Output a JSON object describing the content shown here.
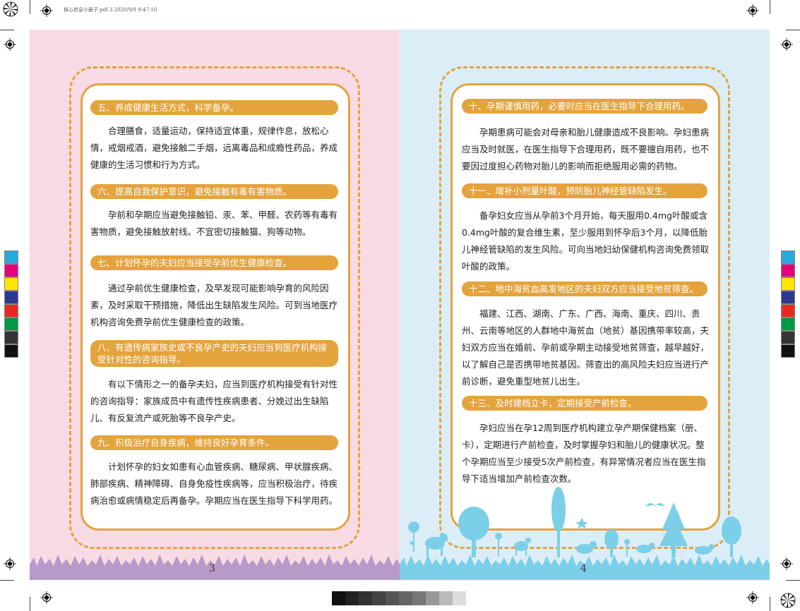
{
  "print_header": "核心信息小册子.pdf   3   2020/9/8   9:47:16",
  "colors": {
    "accent": "#e4a33c",
    "left_bg": "#f9dbe5",
    "right_bg": "#dbeef8",
    "left_grass": "#b89ac9",
    "right_grass": "#7ccfe8"
  },
  "left_page": {
    "page_number": "3",
    "sections": [
      {
        "heading": "五、养成健康生活方式，科学备孕。",
        "body": "合理膳食，适量运动，保持适宜体重，规律作息，放松心情，戒烟戒酒，避免接触二手烟，远离毒品和成瘾性药品，养成健康的生活习惯和行为方式。"
      },
      {
        "heading": "六、提高自我保护意识，避免接触有毒有害物质。",
        "body": "孕前和孕期应当避免接触铅、汞、苯、甲醛、农药等有毒有害物质，避免接触放射线。不宜密切接触猫、狗等动物。"
      },
      {
        "heading": "七、计划怀孕的夫妇应当接受孕前优生健康检查。",
        "body": "通过孕前优生健康检查，及早发现可能影响孕育的风险因素，及时采取干预措施，降低出生缺陷发生风险。可到当地医疗机构咨询免费孕前优生健康检查的政策。"
      },
      {
        "heading": "八、有遗传病家族史或不良孕产史的夫妇应当到医疗机构接受针对性的咨询指导。",
        "body": "有以下情形之一的备孕夫妇，应当到医疗机构接受有针对性的咨询指导：家族成员中有遗传性疾病患者、分娩过出生缺陷儿、有反复流产或死胎等不良孕产史。"
      },
      {
        "heading": "九、积极治疗自身疾病，维持良好孕育条件。",
        "body": "计划怀孕的妇女如患有心血管疾病、糖尿病、甲状腺疾病、肺部疾病、精神障碍、自身免疫性疾病等，应当积极治疗，待疾病治愈或病情稳定后再备孕。孕期应当在医生指导下科学用药。"
      }
    ]
  },
  "right_page": {
    "page_number": "4",
    "sections": [
      {
        "heading": "十、孕期谨慎用药，必要时应当在医生指导下合理用药。",
        "body": "孕期患病可能会对母亲和胎儿健康造成不良影响。孕妇患病应当及时就医，在医生指导下合理用药，既不要擅自用药，也不要因过度担心药物对胎儿的影响而拒绝服用必需的药物。"
      },
      {
        "heading": "十一、增补小剂量叶酸，预防胎儿神经管缺陷发生。",
        "body": "备孕妇女应当从孕前3个月开始，每天服用0.4mg叶酸或含0.4mg叶酸的复合维生素，至少服用到怀孕后3个月，以降低胎儿神经管缺陷的发生风险。可向当地妇幼保健机构咨询免费领取叶酸的政策。"
      },
      {
        "heading": "十二、地中海贫血高发地区的夫妇双方应当接受地贫筛查。",
        "body": "福建、江西、湖南、广东、广西、海南、重庆、四川、贵州、云南等地区的人群地中海贫血（地贫）基因携带率较高，夫妇双方应当在婚前、孕前或孕期主动接受地贫筛查，越早越好，以了解自己是否携带地贫基因。筛查出的高风险夫妇应当进行产前诊断，避免重型地贫儿出生。"
      },
      {
        "heading": "十三、及时建档立卡，定期接受产前检查。",
        "body": "孕妇应当在孕12周到医疗机构建立孕产期保健档案（册、卡），定期进行产前检查，及时掌握孕妇和胎儿的健康状况。整个孕期应当至少接受5次产前检查，有异常情况者应当在医生指导下适当增加产前检查次数。"
      }
    ]
  },
  "icons": [
    "registration-mark-icon",
    "star-target-icon",
    "tree-icon",
    "flower-icon",
    "bird-icon",
    "animal-silhouette-icon",
    "grass-icon"
  ],
  "color_bar": [
    "#29a8e0",
    "#e6007e",
    "#ffe600",
    "#2b3a8f",
    "#e52a22",
    "#009944",
    "#333333",
    "#111111"
  ],
  "gray_strip": [
    "#111111",
    "#222222",
    "#333333",
    "#444444",
    "#555555",
    "#666666",
    "#777777",
    "#999999",
    "#bbbbbb",
    "#dddddd"
  ]
}
